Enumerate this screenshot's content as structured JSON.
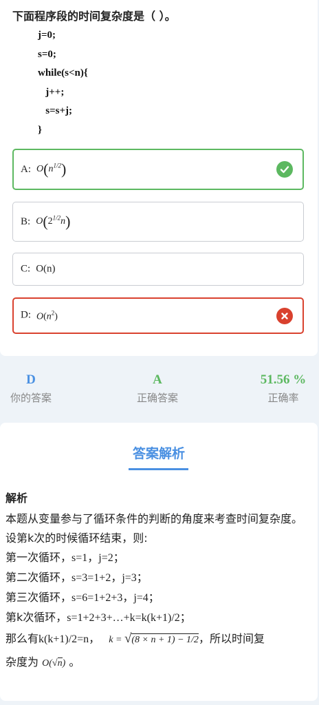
{
  "question": {
    "title": "下面程序段的时间复杂度是（ ）。",
    "code": [
      "j=0;",
      "s=0;",
      "while(s<n){",
      "   j++;",
      "   s=s+j;",
      "}"
    ]
  },
  "options": [
    {
      "label": "A:",
      "big_o": "O",
      "base": "n",
      "exp": "1/2",
      "status": "correct",
      "icon": "check-icon",
      "color": "#5cb860"
    },
    {
      "label": "B:",
      "big_o": "O",
      "base": "2",
      "exp": "1/2",
      "suffix": "n",
      "status": "normal"
    },
    {
      "label": "C:",
      "text": "O(n)",
      "status": "normal"
    },
    {
      "label": "D:",
      "big_o": "O",
      "base": "n",
      "exp": "2",
      "status": "wrong",
      "icon": "x-icon",
      "color": "#d9412e"
    }
  ],
  "stats": {
    "your_answer": "D",
    "your_answer_label": "你的答案",
    "correct_answer": "A",
    "correct_answer_label": "正确答案",
    "rate": "51.56 %",
    "rate_label": "正确率"
  },
  "explanation": {
    "heading": "答案解析",
    "subheading": "解析",
    "p1": "本题从变量参与了循环条件的判断的角度来考查时间复杂度。",
    "p2": "设第k次的时候循环结束，则:",
    "p3a": "第一次循环，",
    "p3b": "s=1，j=2；",
    "p4a": "第二次循环，",
    "p4b": "s=3=1+2，j=3；",
    "p5a": "第三次循环，",
    "p5b": "s=6=1+2+3，j=4；",
    "p6a": "第k次循环，",
    "p6b": "s=1+2+3+…+k=k(k+1)/2；",
    "p7a": "那么有",
    "p7b": "k(k+1)/2=n，",
    "formula_lhs": "k =",
    "formula_rad": "(8 × n + 1) − 1/2",
    "p7c": "，所以时间复",
    "p8a": "杂度为",
    "p8_o": "O(",
    "p8_rad": "n",
    "p8_close": ")",
    "p8b": "。"
  },
  "colors": {
    "accent": "#4a90e2",
    "correct": "#5cb860",
    "wrong": "#d9412e"
  }
}
